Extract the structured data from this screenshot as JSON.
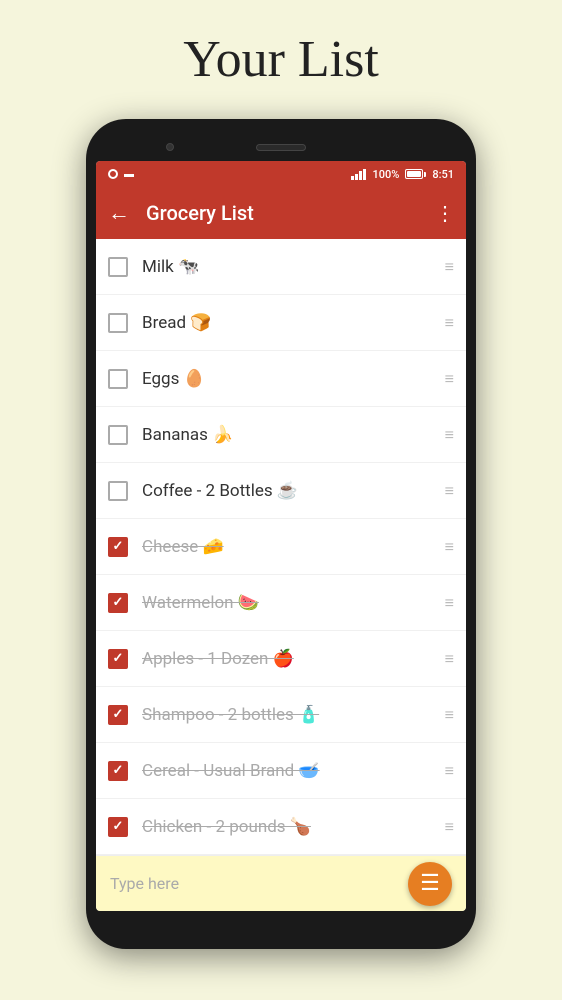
{
  "page": {
    "title": "Your List"
  },
  "statusBar": {
    "battery": "100%",
    "time": "8:51"
  },
  "toolbar": {
    "title": "Grocery List",
    "backLabel": "←",
    "moreLabel": "⋮"
  },
  "items": [
    {
      "id": 1,
      "text": "Milk 🐄",
      "checked": false
    },
    {
      "id": 2,
      "text": "Bread 🍞",
      "checked": false
    },
    {
      "id": 3,
      "text": "Eggs 🥚",
      "checked": false
    },
    {
      "id": 4,
      "text": "Bananas 🍌",
      "checked": false
    },
    {
      "id": 5,
      "text": "Coffee - 2 Bottles ☕",
      "checked": false
    },
    {
      "id": 6,
      "text": "Cheese 🧀",
      "checked": true
    },
    {
      "id": 7,
      "text": "Watermelon 🍉",
      "checked": true
    },
    {
      "id": 8,
      "text": "Apples - 1 Dozen 🍎",
      "checked": true
    },
    {
      "id": 9,
      "text": "Shampoo - 2 bottles 🧴",
      "checked": true
    },
    {
      "id": 10,
      "text": "Cereal - Usual Brand 🥣",
      "checked": true
    },
    {
      "id": 11,
      "text": "Chicken - 2 pounds 🍗",
      "checked": true
    }
  ],
  "inputBar": {
    "placeholder": "Type here"
  },
  "fab": {
    "icon": "≡"
  }
}
